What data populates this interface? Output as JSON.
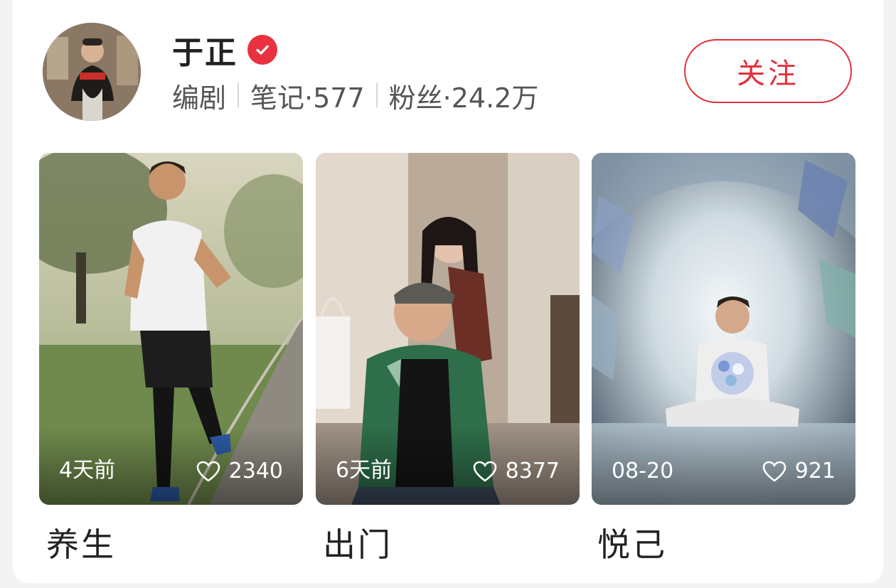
{
  "profile": {
    "name": "于正",
    "verified_icon": "verified-check-icon",
    "role": "编剧",
    "notes_label": "笔记·577",
    "fans_label": "粉丝·24.2万",
    "follow_label": "关注"
  },
  "colors": {
    "accent": "#e0323d",
    "text_primary": "#222222",
    "text_secondary": "#555555"
  },
  "notes": [
    {
      "date": "4天前",
      "likes": "2340",
      "caption": "养生",
      "like_icon": "heart-outline-icon"
    },
    {
      "date": "6天前",
      "likes": "8377",
      "caption": "出门",
      "like_icon": "heart-outline-icon"
    },
    {
      "date": "08-20",
      "likes": "921",
      "caption": "悦己",
      "like_icon": "heart-outline-icon"
    }
  ]
}
